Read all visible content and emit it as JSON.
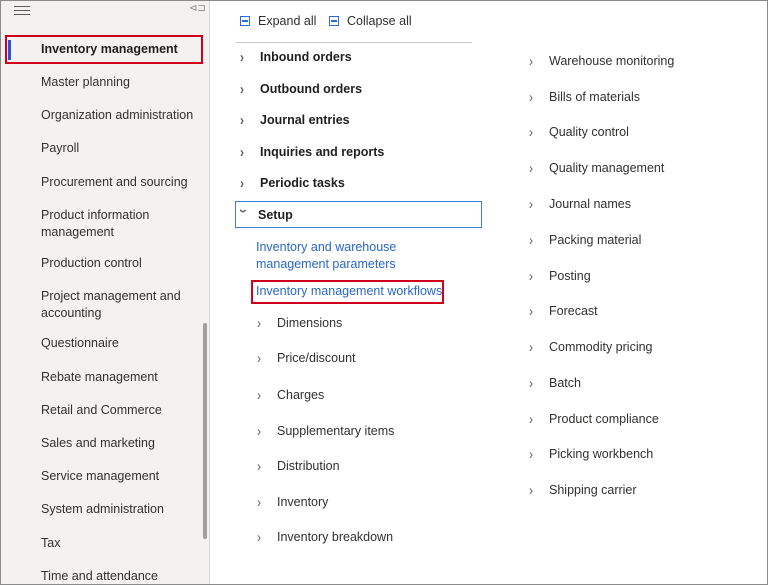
{
  "sidebar": {
    "items": [
      {
        "label": "Inventory management"
      },
      {
        "label": "Master planning"
      },
      {
        "label": "Organization administration"
      },
      {
        "label": "Payroll"
      },
      {
        "label": "Procurement and sourcing"
      },
      {
        "label": "Product information management"
      },
      {
        "label": "Production control"
      },
      {
        "label": "Project management and accounting"
      },
      {
        "label": "Questionnaire"
      },
      {
        "label": "Rebate management"
      },
      {
        "label": "Retail and Commerce"
      },
      {
        "label": "Sales and marketing"
      },
      {
        "label": "Service management"
      },
      {
        "label": "System administration"
      },
      {
        "label": "Tax"
      },
      {
        "label": "Time and attendance"
      }
    ]
  },
  "toolbar": {
    "expand_all": "Expand all",
    "collapse_all": "Collapse all"
  },
  "tree": {
    "groups": [
      {
        "label": "Inbound orders"
      },
      {
        "label": "Outbound orders"
      },
      {
        "label": "Journal entries"
      },
      {
        "label": "Inquiries and reports"
      },
      {
        "label": "Periodic tasks"
      },
      {
        "label": "Setup"
      }
    ],
    "setup_links": [
      {
        "label": "Inventory and warehouse management parameters"
      },
      {
        "label": "Inventory management workflows"
      }
    ],
    "setup_children": [
      {
        "label": "Dimensions"
      },
      {
        "label": "Price/discount"
      },
      {
        "label": "Charges"
      },
      {
        "label": "Supplementary items"
      },
      {
        "label": "Distribution"
      },
      {
        "label": "Inventory"
      },
      {
        "label": "Inventory breakdown"
      }
    ],
    "right_column": [
      {
        "label": "Warehouse monitoring"
      },
      {
        "label": "Bills of materials"
      },
      {
        "label": "Quality control"
      },
      {
        "label": "Quality management"
      },
      {
        "label": "Journal names"
      },
      {
        "label": "Packing material"
      },
      {
        "label": "Posting"
      },
      {
        "label": "Forecast"
      },
      {
        "label": "Commodity pricing"
      },
      {
        "label": "Batch"
      },
      {
        "label": "Product compliance"
      },
      {
        "label": "Picking workbench"
      },
      {
        "label": "Shipping carrier"
      }
    ]
  }
}
